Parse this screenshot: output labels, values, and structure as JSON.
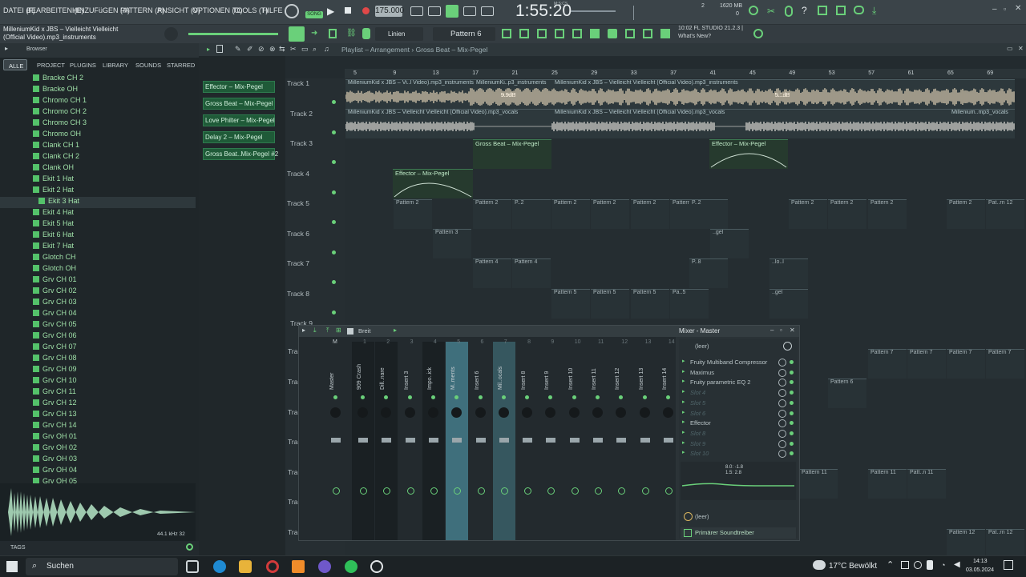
{
  "menu": [
    "DATEI (F)",
    "BEARBEITEN (E)",
    "HINZUFüGEN (A)",
    "PATTERN (P)",
    "ANSICHT (V)",
    "OPTIONEN (O)",
    "TOOLS (T)",
    "HILFE"
  ],
  "transport": {
    "tempo": "175.000",
    "time": "1:55:20",
    "time_label": "M:S:CS",
    "memory": "1620 MB",
    "voices": "2",
    "poly": "0",
    "rec_label": "REC",
    "song_label": "SONG"
  },
  "hint_bar": {
    "line1": "MilleniumKid x JBS – Vielleicht Vielleicht",
    "line2": "(Official Video).mp3_instruments"
  },
  "toolbar2": {
    "snap": "Linien",
    "pattern": "Pattern 6",
    "news_time": "10:02",
    "news_title": "FL STUDIO 21.2.3 |",
    "news_sub": "What's New?"
  },
  "browser": {
    "title": "Browser",
    "tabs": [
      "ALLE",
      "PROJECT",
      "PLUGINS",
      "LIBRARY",
      "SOUNDS",
      "STARRED"
    ],
    "items": [
      "Bracke CH 2",
      "Bracke OH",
      "Chromo CH 1",
      "Chromo CH 2",
      "Chromo CH 3",
      "Chromo OH",
      "Clank CH 1",
      "Clank CH 2",
      "Clank OH",
      "Ekit 1 Hat",
      "Ekit 2 Hat",
      "Ekit 3 Hat",
      "Ekit 4 Hat",
      "Ekit 5 Hat",
      "Ekit 6 Hat",
      "Ekit 7 Hat",
      "Glotch CH",
      "Glotch OH",
      "Grv CH 01",
      "Grv CH 02",
      "Grv CH 03",
      "Grv CH 04",
      "Grv CH 05",
      "Grv CH 06",
      "Grv CH 07",
      "Grv CH 08",
      "Grv CH 09",
      "Grv CH 10",
      "Grv CH 11",
      "Grv CH 12",
      "Grv CH 13",
      "Grv CH 14",
      "Grv OH 01",
      "Grv OH 02",
      "Grv OH 03",
      "Grv OH 04",
      "Grv OH 05"
    ],
    "sample_info": "44.1 kHz 32",
    "tags_label": "TAGS"
  },
  "playlist": {
    "breadcrumb": "Playlist – Arrangement › Gross Beat – Mix-Pegel",
    "side_clips": [
      "Effector – Mix-Pegel",
      "Gross Beat – Mix-Pegel",
      "Love Philter – Mix-Pegel",
      "Delay 2 – Mix-Pegel",
      "Gross Beat..Mix-Pegel #2"
    ],
    "ruler": [
      "5",
      "9",
      "13",
      "17",
      "21",
      "25",
      "29",
      "33",
      "37",
      "41",
      "45",
      "49",
      "53",
      "57",
      "61",
      "65",
      "69"
    ],
    "tracks": [
      "Track 1",
      "Track 2",
      "Track 3",
      "Track 4",
      "Track 5",
      "Track 6",
      "Track 7",
      "Track 8",
      "Track 9"
    ],
    "truncated_tracks": [
      "Tra",
      "Tra",
      "Tra",
      "Tra",
      "Tra",
      "Tra",
      "Tra"
    ],
    "audio_clips": {
      "inst_a": "MilleniumKid x JBS – Vi..l Video).mp3_instruments",
      "inst_b": "MilleniumKi..p3_instruments",
      "inst_c": "MilleniumKid x JBS – Vielleicht Vielleicht (Official Video).mp3_instruments",
      "voc_a": "MilleniumKid x JBS – Vielleicht Vielleicht (Official Video).mp3_vocals",
      "voc_b": "MilleniumKid x JBS – Vielleicht Vielleicht (Official Video).mp3_vocals",
      "voc_c": "Millenium..mp3_vocals",
      "db1": "9.9dB",
      "db2": "5.1dB"
    },
    "automation": {
      "gross1": "Gross Beat – Mix-Pegel",
      "eff1": "Effector – Mix-Pegel",
      "eff2": "Effector – Mix-Pegel"
    },
    "patterns": {
      "p2": "Pattern 2",
      "p3": "Pattern 3",
      "p4": "Pattern 4",
      "p5": "Pattern 5",
      "p6": "Pattern 6",
      "p7": "Pattern 7",
      "p11": "Pattern 11",
      "p12": "Pattern 12",
      "pat_n": "Patt..n 11",
      "pat_m": "Pat..rn 12",
      "p_short": "P..2",
      "pa5": "Pa..5",
      "p8": "P..8",
      "gel": "..gel",
      "lo": "..lo..l"
    }
  },
  "mixer": {
    "title": "Mixer - Master",
    "width_label": "Breit",
    "master_label": "M",
    "channels": [
      "Master",
      "909 Crash",
      "Dill..nare",
      "Insert 3",
      "Impo..ick",
      "M..ments",
      "Insert 6",
      "Mil..ocals",
      "Insert 8",
      "Insert 9",
      "Insert 10",
      "Insert 11",
      "Insert 12",
      "Insert 13",
      "Insert 14"
    ],
    "numbers": [
      "1",
      "2",
      "3",
      "4",
      "5",
      "6",
      "7",
      "8",
      "9",
      "10",
      "11",
      "12",
      "13",
      "14"
    ],
    "preset": "(leer)",
    "slots": [
      "Fruity Multiband Compressor",
      "Maximus",
      "Fruity parametric EQ 2",
      "Slot 4",
      "Slot 5",
      "Slot 6",
      "Effector",
      "Slot 8",
      "Slot 9",
      "Slot 10"
    ],
    "eq_readout": "8.0: -1.8\n1.5: 2.8",
    "bottom_slot": "(leer)",
    "driver": "Primärer Soundtreiber"
  },
  "taskbar": {
    "search": "Suchen",
    "weather": "17°C Bewölkt",
    "time": "14:13",
    "date": "03.05.2024"
  },
  "colors": {
    "accent": "#6ad07a",
    "waveform": "#e8d8bc",
    "clip_bg": "#2d383c",
    "mixer_sel": "#3f6f7c"
  }
}
